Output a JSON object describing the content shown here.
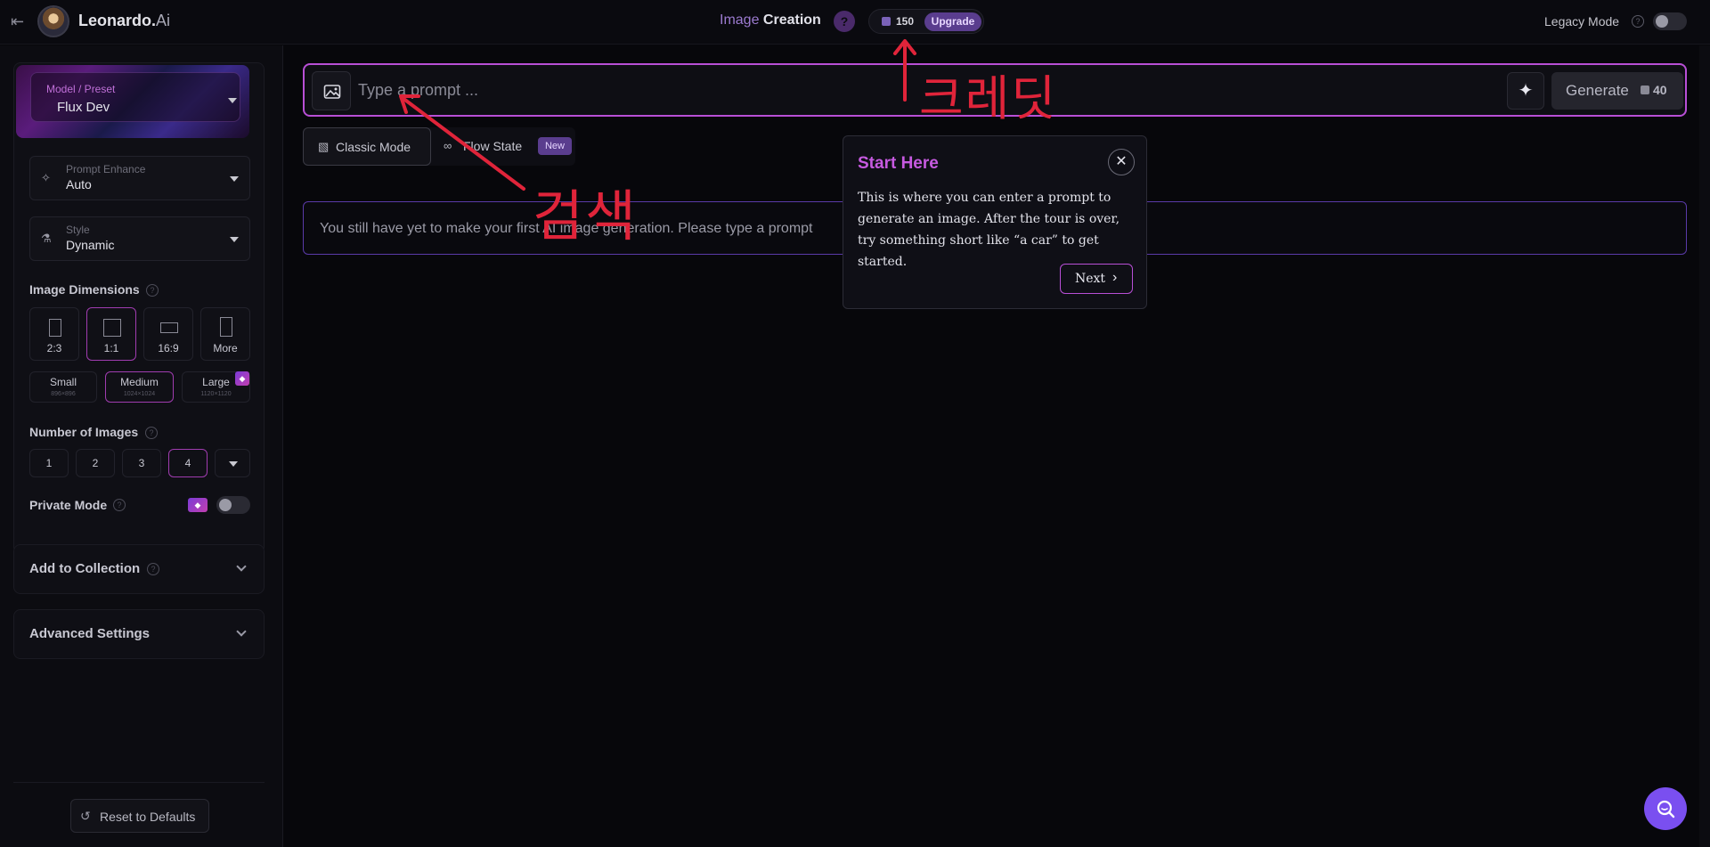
{
  "header": {
    "brand_main": "Leonardo.",
    "brand_ai": "Ai",
    "title_part1": "Image",
    "title_part2": "Creation",
    "help": "?",
    "credits": "150",
    "upgrade": "Upgrade",
    "legacy_mode": "Legacy Mode",
    "legacy_help": "?"
  },
  "sidebar": {
    "model_label": "Model / Preset",
    "model_value": "Flux Dev",
    "prompt_enhance_label": "Prompt Enhance",
    "prompt_enhance_value": "Auto",
    "style_label": "Style",
    "style_value": "Dynamic",
    "dimensions_title": "Image Dimensions",
    "dimensions": [
      "2:3",
      "1:1",
      "16:9",
      "More"
    ],
    "sizes": [
      {
        "label": "Small",
        "sub": "896×896"
      },
      {
        "label": "Medium",
        "sub": "1024×1024"
      },
      {
        "label": "Large",
        "sub": "1120×1120"
      }
    ],
    "num_images_title": "Number of Images",
    "num_images": [
      "1",
      "2",
      "3",
      "4"
    ],
    "private_mode": "Private Mode",
    "add_to_collection": "Add to Collection",
    "advanced_settings": "Advanced Settings",
    "reset": "Reset to Defaults"
  },
  "main": {
    "prompt_placeholder": "Type a prompt ...",
    "generate": "Generate",
    "generate_cost": "40",
    "tabs": [
      {
        "label": "Classic Mode"
      },
      {
        "label": "Flow State",
        "badge": "New"
      }
    ],
    "notice": "You still have yet to make your first AI image generation. Please type a prompt"
  },
  "tour": {
    "title": "Start Here",
    "body": "This is where you can enter a prompt to generate an image. After the tour is over, try something short like “a car” to get started.",
    "next": "Next"
  },
  "annotations": {
    "credit_note": "크레딧",
    "search_note": "검색"
  },
  "colors": {
    "accent": "#b84fd6",
    "annotation_red": "#e0243a",
    "fab": "#7a4ff0"
  }
}
